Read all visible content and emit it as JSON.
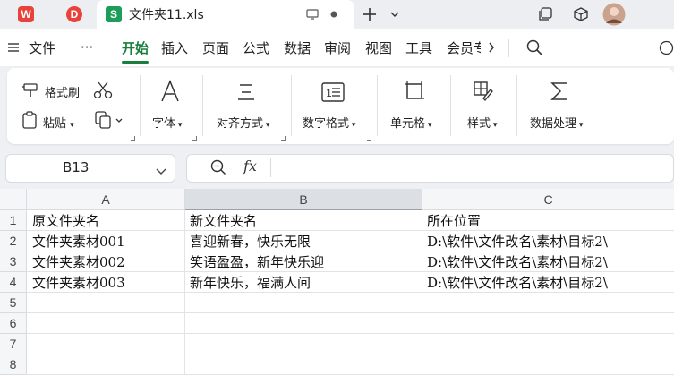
{
  "titlebar": {
    "doc_title": "文件夹11.xls",
    "app_logo_letter": "W",
    "pdf_logo_letter": "D",
    "doc_icon_letter": "S"
  },
  "menu": {
    "file": "文件",
    "more": "···",
    "items": [
      "开始",
      "插入",
      "页面",
      "公式",
      "数据",
      "审阅",
      "视图",
      "工具",
      "会员专"
    ]
  },
  "ribbon": {
    "format_painter": "格式刷",
    "paste": "粘贴",
    "font": "字体",
    "align": "对齐方式",
    "number_format": "数字格式",
    "cell": "单元格",
    "style": "样式",
    "data_processing": "数据处理"
  },
  "formula_bar": {
    "name_box": "B13",
    "fx_label": "fx",
    "formula": ""
  },
  "sheet": {
    "columns": [
      "A",
      "B",
      "C"
    ],
    "row_numbers": [
      "1",
      "2",
      "3",
      "4",
      "5",
      "6",
      "7",
      "8"
    ],
    "rows": [
      [
        "原文件夹名",
        "新文件夹名",
        "所在位置"
      ],
      [
        "文件夹素材001",
        "喜迎新春，快乐无限",
        "D:\\软件\\文件改名\\素材\\目标2\\"
      ],
      [
        "文件夹素材002",
        "笑语盈盈，新年快乐迎",
        "D:\\软件\\文件改名\\素材\\目标2\\"
      ],
      [
        "文件夹素材003",
        "新年快乐，福满人间",
        "D:\\软件\\文件改名\\素材\\目标2\\"
      ]
    ]
  },
  "colors": {
    "accent": "#1a7f3c",
    "wps_red": "#e8423a",
    "xls_green": "#1e9d5a"
  }
}
